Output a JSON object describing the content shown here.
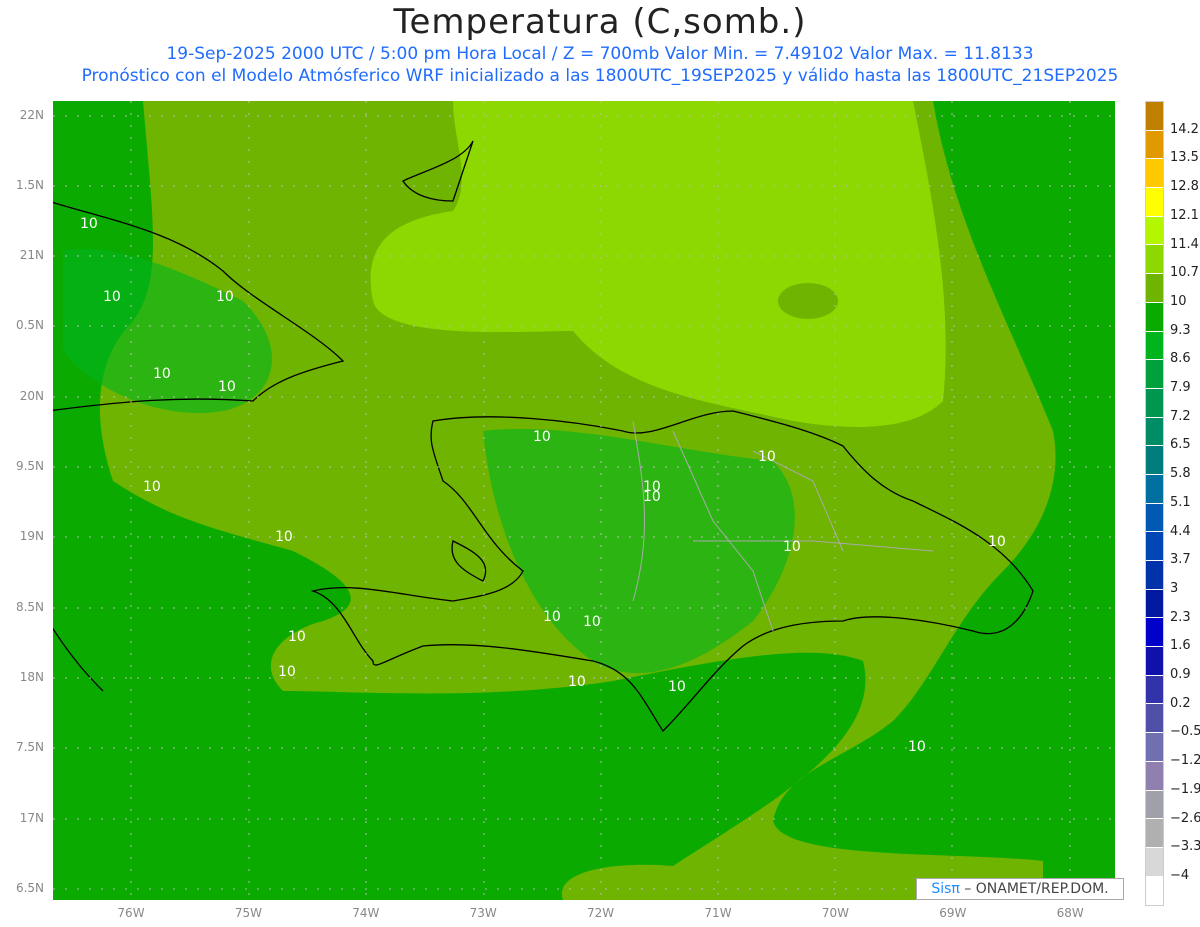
{
  "title": "Temperatura (C,somb.)",
  "subtitle1": "19-Sep-2025  2000 UTC / 5:00 pm Hora Local / Z = 700mb    Valor Min. = 7.49102  Valor Max. = 11.8133",
  "subtitle2": "Pronóstico con el Modelo Atmósferico WRF inicializado a las 1800UTC_19SEP2025 y válido hasta las  1800UTC_21SEP2025",
  "lat_labels": [
    "22N",
    "1.5N",
    "21N",
    "0.5N",
    "20N",
    "9.5N",
    "19N",
    "8.5N",
    "18N",
    "7.5N",
    "17N",
    "6.5N"
  ],
  "lon_labels": [
    "76W",
    "75W",
    "74W",
    "73W",
    "72W",
    "71W",
    "70W",
    "69W",
    "68W"
  ],
  "colorbar": {
    "labels": [
      "14.2",
      "13.5",
      "12.8",
      "12.1",
      "11.4",
      "10.7",
      "10",
      "9.3",
      "8.6",
      "7.9",
      "7.2",
      "6.5",
      "5.8",
      "5.1",
      "4.4",
      "3.7",
      "3",
      "2.3",
      "1.6",
      "0.9",
      "0.2",
      "−0.5",
      "−1.2",
      "−1.9",
      "−2.6",
      "−3.3",
      "−4"
    ],
    "colors": [
      "#bf7f00",
      "#e09a00",
      "#ffc800",
      "#ffff00",
      "#b4f500",
      "#8cd800",
      "#6eb400",
      "#0aaa00",
      "#00b41e",
      "#00a03c",
      "#009650",
      "#008c64",
      "#007c7c",
      "#0070a0",
      "#005ab4",
      "#0046b4",
      "#0032aa",
      "#0019a0",
      "#0000c8",
      "#1010aa",
      "#3232aa",
      "#5050a8",
      "#7070b0",
      "#9080b0",
      "#a0a0aa",
      "#b0b0b0",
      "#d8d8d8",
      "#ffffff"
    ]
  },
  "contour_labels": [
    "10",
    "10",
    "10",
    "10",
    "10",
    "10",
    "10",
    "10",
    "10",
    "10",
    "10",
    "10",
    "10",
    "10",
    "10",
    "10",
    "10",
    "10",
    "10",
    "10"
  ],
  "credit": {
    "brand": "Sisπ",
    "text": " – ONAMET/REP.DOM."
  }
}
